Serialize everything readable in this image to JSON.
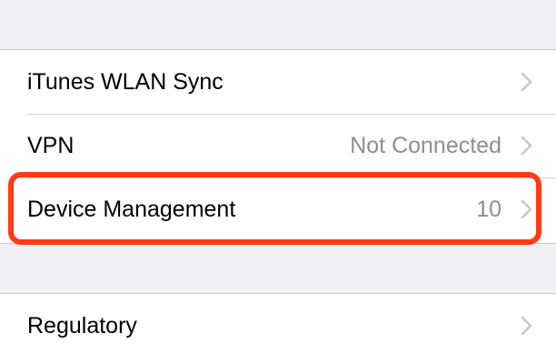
{
  "settings": {
    "group1": [
      {
        "label": "iTunes WLAN Sync",
        "value": ""
      },
      {
        "label": "VPN",
        "value": "Not Connected"
      },
      {
        "label": "Device Management",
        "value": "10"
      }
    ],
    "group2": [
      {
        "label": "Regulatory",
        "value": ""
      }
    ]
  },
  "icons": {
    "row_disclosure": "chevron-right-icon"
  },
  "colors": {
    "background": "#efeff4",
    "cell": "#ffffff",
    "label": "#000000",
    "value": "#8e8e93",
    "chevron": "#c7c7cc",
    "highlight": "#ff3b14"
  }
}
